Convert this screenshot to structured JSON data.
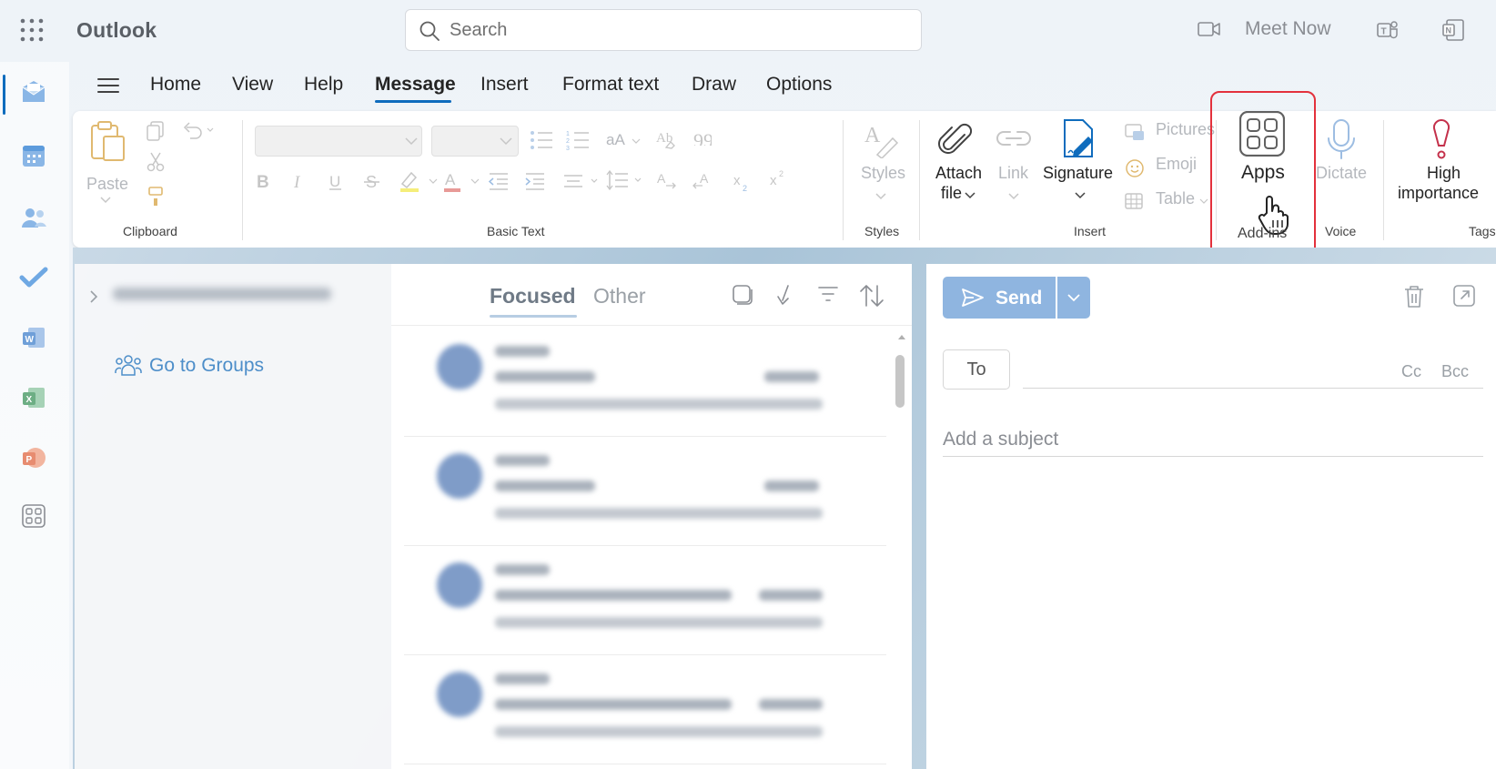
{
  "app": {
    "name": "Outlook"
  },
  "search": {
    "placeholder": "Search"
  },
  "header": {
    "meet_now": "Meet Now"
  },
  "ribbon_tabs": [
    {
      "label": "Home"
    },
    {
      "label": "View"
    },
    {
      "label": "Help"
    },
    {
      "label": "Message",
      "active": true
    },
    {
      "label": "Insert"
    },
    {
      "label": "Format text"
    },
    {
      "label": "Draw"
    },
    {
      "label": "Options"
    }
  ],
  "ribbon": {
    "clipboard": {
      "paste": "Paste",
      "group": "Clipboard"
    },
    "basic_text": {
      "font_style_label": "aA",
      "group": "Basic Text"
    },
    "styles": {
      "label": "Styles",
      "group": "Styles"
    },
    "insert": {
      "attach": "Attach",
      "attach_2": "file",
      "link": "Link",
      "signature": "Signature",
      "pictures": "Pictures",
      "emoji": "Emoji",
      "table": "Table",
      "group": "Insert"
    },
    "addins": {
      "apps": "Apps",
      "group": "Add-ins"
    },
    "voice": {
      "dictate": "Dictate",
      "group": "Voice"
    },
    "tags": {
      "high": "High",
      "importance": "importance",
      "group": "Tags"
    }
  },
  "folder_pane": {
    "go_to_groups": "Go to Groups"
  },
  "mail_list": {
    "tabs": {
      "focused": "Focused",
      "other": "Other"
    }
  },
  "compose": {
    "send": "Send",
    "to": "To",
    "cc": "Cc",
    "bcc": "Bcc",
    "subject_placeholder": "Add a subject"
  },
  "colors": {
    "accent": "#0f6cbd",
    "highlight_box": "#e3313c",
    "send_button": "#8fb5e0"
  }
}
